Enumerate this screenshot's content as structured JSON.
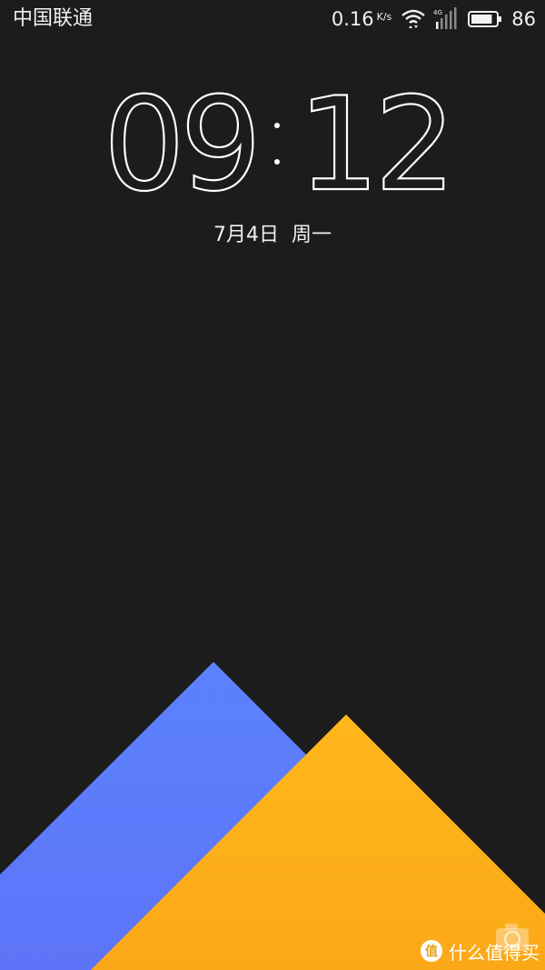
{
  "status_bar": {
    "carrier": "中国联通",
    "net_speed": "0.16",
    "net_speed_unit": "K/s",
    "network_type": "4G",
    "battery_percent": "86",
    "battery_level": 0.86
  },
  "lockscreen": {
    "time": "09 : 12",
    "hours": "09",
    "minutes": "12",
    "date_month_day": "7月4日",
    "weekday": "周一"
  },
  "wallpaper": {
    "colors": {
      "background": "#1c1c1c",
      "blue": "#5a7cff",
      "yellow": "#ffb31a"
    }
  },
  "shortcut": {
    "icon": "camera-icon"
  },
  "watermark": {
    "text": "什么值得买"
  }
}
